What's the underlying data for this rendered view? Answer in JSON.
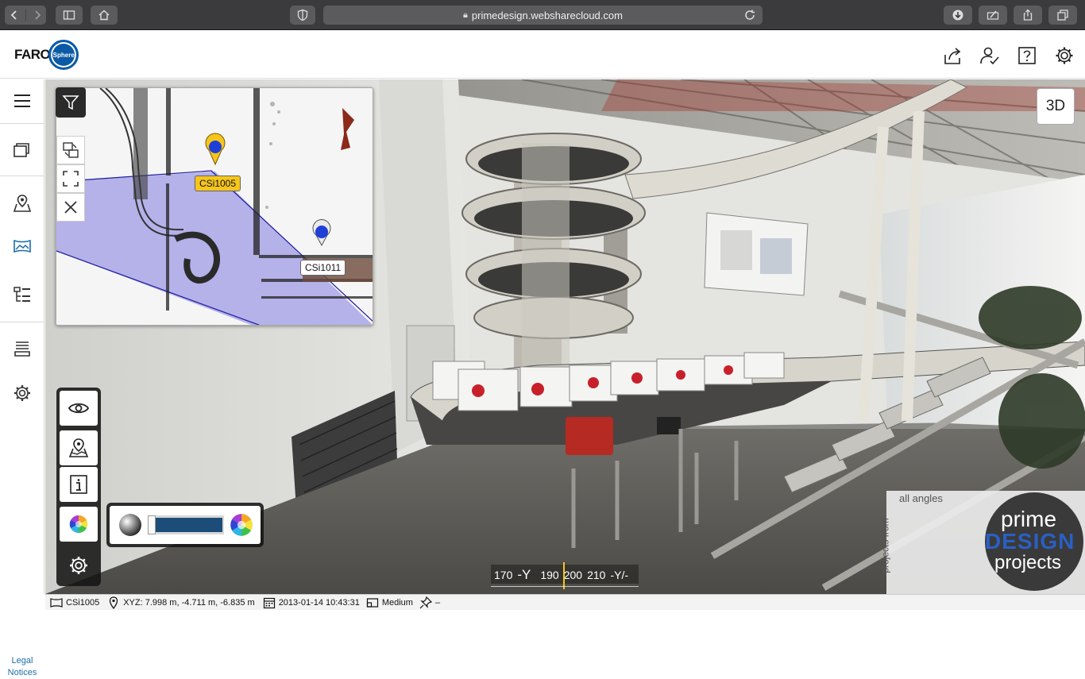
{
  "browser": {
    "url": "primedesign.websharecloud.com"
  },
  "header": {
    "logo_text": "FARO",
    "logo_badge": "Sphere"
  },
  "sidebar": {
    "legal_line1": "Legal",
    "legal_line2": "Notices"
  },
  "minimap": {
    "pins": [
      {
        "label": "CSi1005",
        "active": true
      },
      {
        "label": "CSi1011",
        "active": false
      }
    ]
  },
  "viewer": {
    "view_mode_button": "3D",
    "compass": {
      "ticks": [
        "170",
        "-Y",
        "190",
        "200",
        "210",
        "-Y/-"
      ]
    },
    "brand": {
      "tagline": "all angles",
      "side_text": "projects from",
      "line1": "prime",
      "line2": "DESIGN",
      "line3": "projects"
    }
  },
  "status": {
    "scan_name": "CSi1005",
    "position": "XYZ: 7.998 m, -4.711 m, -6.835 m",
    "datetime": "2013-01-14 10:43:31",
    "resolution": "Medium",
    "pin_value": "–"
  },
  "colors": {
    "accent": "#1a6fa8",
    "pin_active": "#f5c51b",
    "pin_blue": "#1f3fd6"
  }
}
